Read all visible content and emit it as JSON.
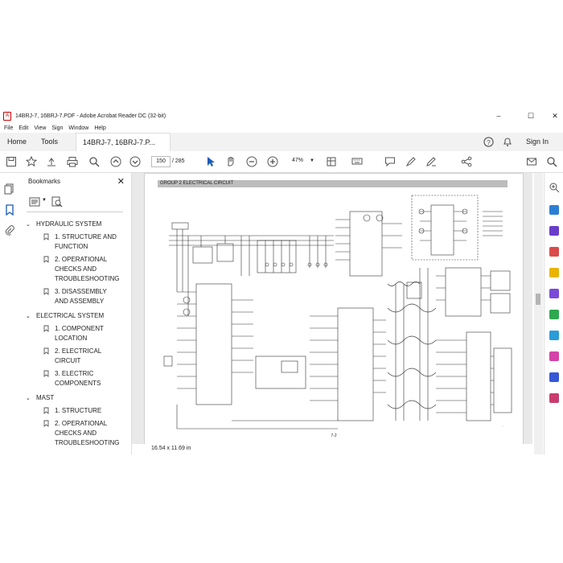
{
  "window": {
    "title": "14BRJ-7, 16BRJ-7.PDF - Adobe Acrobat Reader DC (32-bit)",
    "minimize": "–",
    "maximize": "☐",
    "close": "✕"
  },
  "menu": [
    "File",
    "Edit",
    "View",
    "Sign",
    "Window",
    "Help"
  ],
  "tabs": {
    "home": "Home",
    "tools": "Tools",
    "document": "14BRJ-7, 16BRJ-7.P...",
    "doc_close": "✕"
  },
  "account": {
    "sign_in": "Sign In"
  },
  "toolbar": {
    "page_current": "150",
    "page_sep": "/",
    "page_total": "285",
    "zoom": "47%"
  },
  "bookmarks": {
    "title": "Bookmarks",
    "items": [
      {
        "label": "HYDRAULIC SYSTEM",
        "level": 1
      },
      {
        "label": "1. STRUCTURE AND",
        "level": 2
      },
      {
        "label": "FUNCTION",
        "level": 3
      },
      {
        "label": "2. OPERATIONAL",
        "level": 2
      },
      {
        "label": "CHECKS AND",
        "level": 3
      },
      {
        "label": "TROUBLESHOOTING",
        "level": 3
      },
      {
        "label": "3. DISASSEMBLY",
        "level": 2
      },
      {
        "label": "AND ASSEMBLY",
        "level": 3
      },
      {
        "label": "ELECTRICAL SYSTEM",
        "level": 1
      },
      {
        "label": "1. COMPONENT",
        "level": 2
      },
      {
        "label": "LOCATION",
        "level": 3
      },
      {
        "label": "2. ELECTRICAL",
        "level": 2
      },
      {
        "label": "CIRCUIT",
        "level": 3
      },
      {
        "label": "3. ELECTRIC",
        "level": 2
      },
      {
        "label": "COMPONENTS",
        "level": 3
      },
      {
        "label": "MAST",
        "level": 1
      },
      {
        "label": "1. STRUCTURE",
        "level": 2
      },
      {
        "label": "2. OPERATIONAL",
        "level": 2
      },
      {
        "label": "CHECKS AND",
        "level": 3
      },
      {
        "label": "TROUBLESHOOTING",
        "level": 3
      }
    ]
  },
  "page": {
    "header": "GROUP 2 ELECTRICAL CIRCUIT",
    "footer": "7-2"
  },
  "status": {
    "dimensions": "16.54 x 11.69 in"
  }
}
